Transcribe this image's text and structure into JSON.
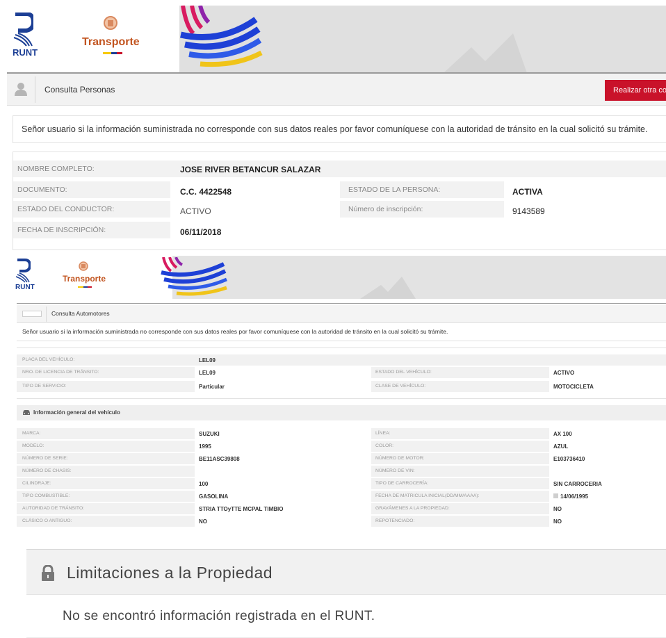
{
  "logos": {
    "runt": "RUNT",
    "transporte": "Transporte"
  },
  "personas": {
    "title": "Consulta Personas",
    "button": "Realizar otra consulta",
    "notice": "Señor usuario si la información suministrada no corresponde con sus datos reales por favor comuníquese con la autoridad de tránsito en la cual solicitó su trámite.",
    "fields": {
      "nombre_label": "NOMBRE COMPLETO:",
      "nombre_value": "JOSE RIVER BETANCUR SALAZAR",
      "documento_label": "DOCUMENTO:",
      "documento_value": "C.C. 4422548",
      "estado_persona_label": "ESTADO DE LA PERSONA:",
      "estado_persona_value": "ACTIVA",
      "estado_conductor_label": "ESTADO DEL CONDUCTOR:",
      "estado_conductor_value": "ACTIVO",
      "inscripcion_label": "Número de inscripción:",
      "inscripcion_value": "9143589",
      "fecha_label": "FECHA DE INSCRIPCIÓN:",
      "fecha_value": "06/11/2018"
    }
  },
  "automotores": {
    "title": "Consulta Automotores",
    "notice": "Señor usuario si la información suministrada no corresponde con sus datos reales por favor comuníquese con la autoridad de tránsito en la cual solicitó su trámite.",
    "placa_label": "PLACA DEL VEHÍCULO:",
    "placa_value": "LEL09",
    "licencia_label": "NRO. DE LICENCIA DE TRÁNSITO:",
    "licencia_value": "LEL09",
    "estado_label": "ESTADO DEL VEHÍCULO:",
    "estado_value": "ACTIVO",
    "servicio_label": "TIPO DE SERVICIO:",
    "servicio_value": "Particular",
    "clase_label": "CLASE DE VEHÍCULO:",
    "clase_value": "MOTOCICLETA",
    "section_title": "Información general del vehículo",
    "general": [
      {
        "l1": "MARCA:",
        "v1": "SUZUKI",
        "l2": "LÍNEA:",
        "v2": "AX 100"
      },
      {
        "l1": "MODELO:",
        "v1": "1995",
        "l2": "COLOR:",
        "v2": "AZUL"
      },
      {
        "l1": "NÚMERO DE SERIE:",
        "v1": "BE11ASC39808",
        "l2": "NÚMERO DE MOTOR:",
        "v2": "E103736410"
      },
      {
        "l1": "NÚMERO DE CHASIS:",
        "v1": "",
        "l2": "NÚMERO DE VIN:",
        "v2": ""
      },
      {
        "l1": "CILINDRAJE:",
        "v1": "100",
        "l2": "TIPO DE CARROCERÍA:",
        "v2": "SIN CARROCERIA"
      },
      {
        "l1": "TIPO COMBUSTIBLE:",
        "v1": "GASOLINA",
        "l2": "FECHA DE MATRICULA INICIAL(DD/MM/AAAA):",
        "v2": "14/06/1995"
      },
      {
        "l1": "AUTORIDAD DE TRÁNSITO:",
        "v1": "STRIA TTOyTTE MCPAL TIMBIO",
        "l2": "GRAVÁMENES A LA PROPIEDAD:",
        "v2": "NO"
      },
      {
        "l1": "CLÁSICO O ANTIGUO:",
        "v1": "NO",
        "l2": "REPOTENCIADO:",
        "v2": "NO"
      }
    ]
  },
  "limitaciones": {
    "title": "Limitaciones a la Propiedad",
    "message": "No se encontró información registrada en el RUNT."
  },
  "colors": {
    "accent_red": "#c9122a",
    "runt_blue": "#1c3f95",
    "transporte_orange": "#c2541f"
  }
}
